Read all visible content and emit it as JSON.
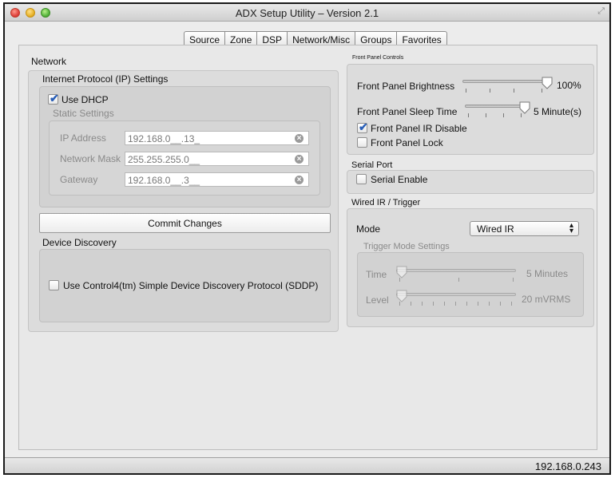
{
  "window": {
    "title": "ADX Setup Utility – Version 2.1"
  },
  "tabs": [
    "Source",
    "Zone",
    "DSP",
    "Network/Misc",
    "Groups",
    "Favorites"
  ],
  "network": {
    "section_title": "Network",
    "ip_settings_title": "Internet Protocol (IP) Settings",
    "use_dhcp_label": "Use DHCP",
    "use_dhcp_checked": true,
    "static_settings_title": "Static Settings",
    "ip_address_label": "IP Address",
    "ip_address_value": "192.168.0__.13_",
    "network_mask_label": "Network Mask",
    "network_mask_value": "255.255.255.0__",
    "gateway_label": "Gateway",
    "gateway_value": "192.168.0__.3__",
    "commit_button": "Commit Changes"
  },
  "device_discovery": {
    "title": "Device Discovery",
    "sddp_label": "Use Control4(tm) Simple Device Discovery Protocol (SDDP)",
    "sddp_checked": false
  },
  "front_panel": {
    "title": "Front Panel Controls",
    "brightness_label": "Front Panel Brightness",
    "brightness_value": "100%",
    "brightness_level": 1.0,
    "sleep_label": "Front Panel Sleep Time",
    "sleep_value": "5 Minute(s)",
    "sleep_level": 1.0,
    "ir_disable_label": "Front Panel IR Disable",
    "ir_disable_checked": true,
    "lock_label": "Front Panel Lock",
    "lock_checked": false
  },
  "serial_port": {
    "title": "Serial Port",
    "enable_label": "Serial Enable",
    "enable_checked": false
  },
  "wired_ir": {
    "title": "Wired IR / Trigger",
    "mode_label": "Mode",
    "mode_value": "Wired IR",
    "trigger_title": "Trigger Mode Settings",
    "time_label": "Time",
    "time_value": "5 Minutes",
    "time_level": 0.0,
    "level_label": "Level",
    "level_value": "20 mVRMS",
    "level_level": 0.0
  },
  "status": {
    "ip": "192.168.0.243"
  },
  "colors": {
    "check_accent": "#2a5fb7",
    "panel_bg": "#ececec"
  }
}
